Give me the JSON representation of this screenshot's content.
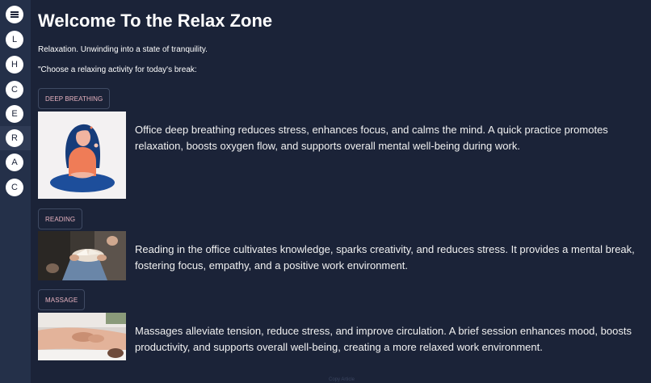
{
  "page": {
    "title": "Welcome To the Relax Zone",
    "subtitle": "Relaxation. Unwinding into a state of tranquility.",
    "prompt": "\"Choose a relaxing activity for today's break:"
  },
  "sidebar": {
    "menu_icon": "hamburger-menu-icon",
    "items": [
      {
        "label": "L"
      },
      {
        "label": "H"
      },
      {
        "label": "C"
      },
      {
        "label": "E"
      },
      {
        "label": "R"
      },
      {
        "label": "A"
      },
      {
        "label": "C"
      }
    ],
    "active_index": 4
  },
  "activities": [
    {
      "button": "Deep breathing",
      "image": "meditating-woman-illustration",
      "description": "Office deep breathing reduces stress, enhances focus, and calms the mind. A quick practice promotes relaxation, boosts oxygen flow, and supports overall mental well-being during work."
    },
    {
      "button": "Reading",
      "image": "person-reading-book-photo",
      "description": "Reading in the office cultivates knowledge, sparks creativity, and reduces stress. It provides a mental break, fostering focus, empathy, and a positive work environment."
    },
    {
      "button": "Massage",
      "image": "back-massage-photo",
      "description": "Massages alleviate tension, reduce stress, and improve circulation. A brief session enhances mood, boosts productivity, and supports overall well-being, creating a more relaxed work environment."
    }
  ],
  "footer": {
    "text": "Copy Article"
  },
  "colors": {
    "background": "#1b2338",
    "sidebar": "#243049",
    "button_text": "#e8b3c0",
    "button_border": "#3f4a63"
  }
}
